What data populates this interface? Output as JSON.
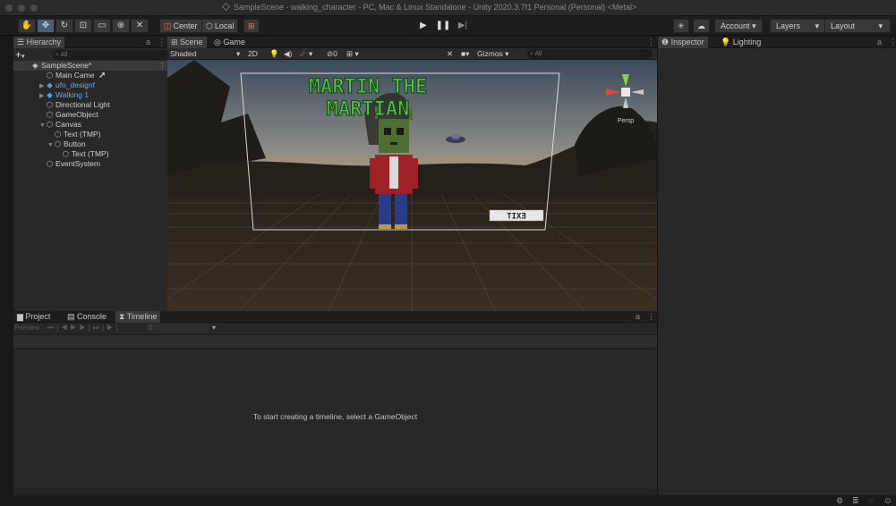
{
  "window": {
    "title": "SampleScene - walking_character - PC, Mac & Linux Standalone - Unity 2020.3.7f1 Personal (Personal) <Metal>"
  },
  "toolbar": {
    "tools": [
      "hand-tool",
      "move-tool",
      "rotate-tool",
      "scale-tool",
      "rect-tool",
      "transform-tool",
      "custom-tool"
    ],
    "pivot_label": "Center",
    "space_label": "Local",
    "account_label": "Account",
    "layers_label": "Layers",
    "layout_label": "Layout"
  },
  "hierarchy": {
    "tab_label": "Hierarchy",
    "search_placeholder": "All",
    "scene_name": "SampleScene*",
    "items": [
      {
        "label": "Main Camera",
        "display": "Main Came",
        "indent": 1,
        "prefab": false,
        "fold": ""
      },
      {
        "label": "ufo_designf",
        "display": "ufo_designf",
        "indent": 1,
        "prefab": true,
        "fold": "▶"
      },
      {
        "label": "Walking 1",
        "display": "Walking 1",
        "indent": 1,
        "prefab": true,
        "fold": "▶"
      },
      {
        "label": "Directional Light",
        "display": "Directional Light",
        "indent": 1,
        "prefab": false,
        "fold": ""
      },
      {
        "label": "GameObject",
        "display": "GameObject",
        "indent": 1,
        "prefab": false,
        "fold": ""
      },
      {
        "label": "Canvas",
        "display": "Canvas",
        "indent": 1,
        "prefab": false,
        "fold": "▼"
      },
      {
        "label": "Text (TMP)",
        "display": "Text (TMP)",
        "indent": 2,
        "prefab": false,
        "fold": ""
      },
      {
        "label": "Button",
        "display": "Button",
        "indent": 2,
        "prefab": false,
        "fold": "▼"
      },
      {
        "label": "Text (TMP)",
        "display": "Text (TMP)",
        "indent": 3,
        "prefab": false,
        "fold": ""
      },
      {
        "label": "EventSystem",
        "display": "EventSystem",
        "indent": 1,
        "prefab": false,
        "fold": ""
      }
    ]
  },
  "scene": {
    "tab_scene": "Scene",
    "tab_game": "Game",
    "shading_mode": "Shaded",
    "mode_2d": "2D",
    "fx_count": "0",
    "gizmos_label": "Gizmos",
    "search_placeholder": "All",
    "persp_label": "Persp",
    "game_title_line1": "MARTIN THE",
    "game_title_line2": "MARTIAN",
    "exit_button_text": "EXIT",
    "colors": {
      "title_green": "#4fc24a",
      "alien_green": "#5a7d3a",
      "shirt_red": "#b0242a",
      "pants_blue": "#2c3f8f"
    }
  },
  "bottom": {
    "tab_project": "Project",
    "tab_console": "Console",
    "tab_timeline": "Timeline",
    "preview_label": "Preview",
    "frame_value": "0",
    "empty_message": "To start creating a timeline, select a GameObject"
  },
  "inspector": {
    "tab_inspector": "Inspector",
    "tab_lighting": "Lighting"
  }
}
